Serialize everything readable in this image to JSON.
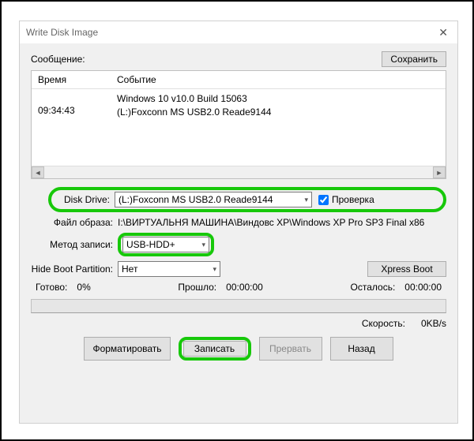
{
  "window": {
    "title": "Write Disk Image"
  },
  "message": {
    "label": "Сообщение:",
    "save_btn": "Сохранить"
  },
  "log": {
    "col_time": "Время",
    "col_event": "Событие",
    "rows": [
      {
        "time": "09:34:43",
        "event1": "Windows 10 v10.0 Build 15063",
        "event2": "(L:)Foxconn MS  USB2.0 Reade9144"
      }
    ]
  },
  "form": {
    "disk_drive_label": "Disk Drive:",
    "disk_drive_value": "(L:)Foxconn MS  USB2.0 Reade9144",
    "verify_label": "Проверка",
    "image_file_label": "Файл образа:",
    "image_file_value": "I:\\ВИРТУАЛЬНЯ МАШИНА\\Виндовс ХР\\Windows XP Pro SP3 Final x86",
    "write_method_label": "Метод записи:",
    "write_method_value": "USB-HDD+",
    "hide_boot_label": "Hide Boot Partition:",
    "hide_boot_value": "Нет",
    "xpress_boot": "Xpress Boot"
  },
  "progress": {
    "ready_label": "Готово:",
    "ready_value": "0%",
    "elapsed_label": "Прошло:",
    "elapsed_value": "00:00:00",
    "remaining_label": "Осталось:",
    "remaining_value": "00:00:00",
    "speed_label": "Скорость:",
    "speed_value": "0KB/s"
  },
  "buttons": {
    "format": "Форматировать",
    "write": "Записать",
    "abort": "Прервать",
    "back": "Назад"
  }
}
